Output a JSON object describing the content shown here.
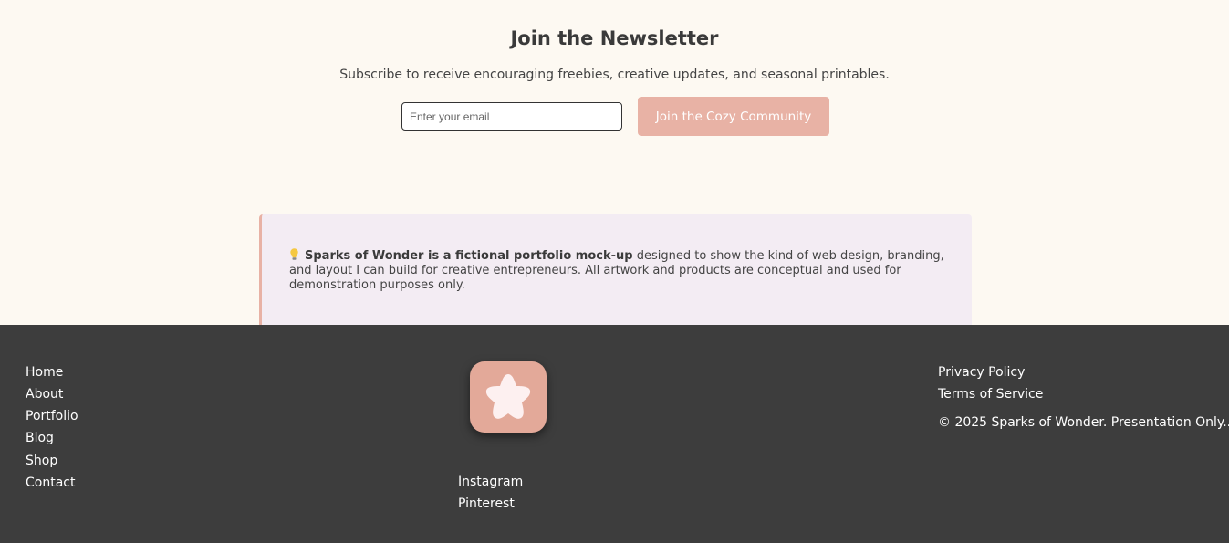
{
  "newsletter": {
    "title": "Join the Newsletter",
    "subtitle": "Subscribe to receive encouraging freebies, creative updates, and seasonal printables.",
    "email_placeholder": "Enter your email",
    "email_value": "",
    "button_label": "Join the Cozy Community"
  },
  "disclaimer": {
    "icon": "lightbulb-icon",
    "bold_text": "Sparks of Wonder is a fictional portfolio mock-up",
    "text": " designed to show the kind of web design, branding, and layout I can build for creative entrepreneurs. All artwork and products are conceptual and used for demonstration purposes only."
  },
  "footer": {
    "nav_links": [
      "Home",
      "About",
      "Portfolio",
      "Blog",
      "Shop",
      "Contact"
    ],
    "logo_icon": "star-flower-icon",
    "social_links": [
      "Instagram",
      "Pinterest"
    ],
    "legal_links": [
      "Privacy Policy",
      "Terms of Service"
    ],
    "copyright": "© 2025 Sparks of Wonder. Presentation Only.."
  },
  "colors": {
    "page_background": "#fdf9f2",
    "accent": "#e8b2a5",
    "note_background": "#f3ecf3",
    "footer_background": "#3d3d3d"
  }
}
